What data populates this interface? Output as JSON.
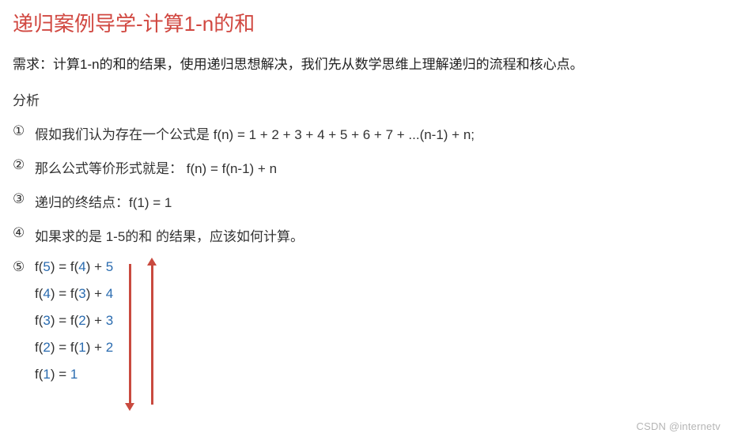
{
  "title": "递归案例导学-计算1-n的和",
  "requirement": "需求：计算1-n的和的结果，使用递归思想解决，我们先从数学思维上理解递归的流程和核心点。",
  "analysis_label": "分析",
  "items": {
    "m1": "①",
    "t1": "假如我们认为存在一个公式是 f(n) = 1 + 2 + 3 + 4 + 5 + 6 + 7 + ...(n-1) + n;",
    "m2": "②",
    "t2": "那么公式等价形式就是：  f(n) = f(n-1)  + n",
    "m3": "③",
    "t3": "递归的终结点：f(1) = 1",
    "m4": "④",
    "t4": "如果求的是 1-5的和 的结果，应该如何计算。",
    "m5": "⑤"
  },
  "eq": {
    "e1_a": "f(",
    "e1_b": "5",
    "e1_c": ") =  f(",
    "e1_d": "4",
    "e1_e": ")  + ",
    "e1_f": "5",
    "e2_a": "f(",
    "e2_b": "4",
    "e2_c": ") =  f(",
    "e2_d": "3",
    "e2_e": ")  + ",
    "e2_f": "4",
    "e3_a": "f(",
    "e3_b": "3",
    "e3_c": ") =  f(",
    "e3_d": "2",
    "e3_e": ")  + ",
    "e3_f": "3",
    "e4_a": "f(",
    "e4_b": "2",
    "e4_c": ") =  f(",
    "e4_d": "1",
    "e4_e": ")  + ",
    "e4_f": "2",
    "e5_a": "f(",
    "e5_b": "1",
    "e5_c": ") =  ",
    "e5_d": "1"
  },
  "watermark": "CSDN @internetv"
}
